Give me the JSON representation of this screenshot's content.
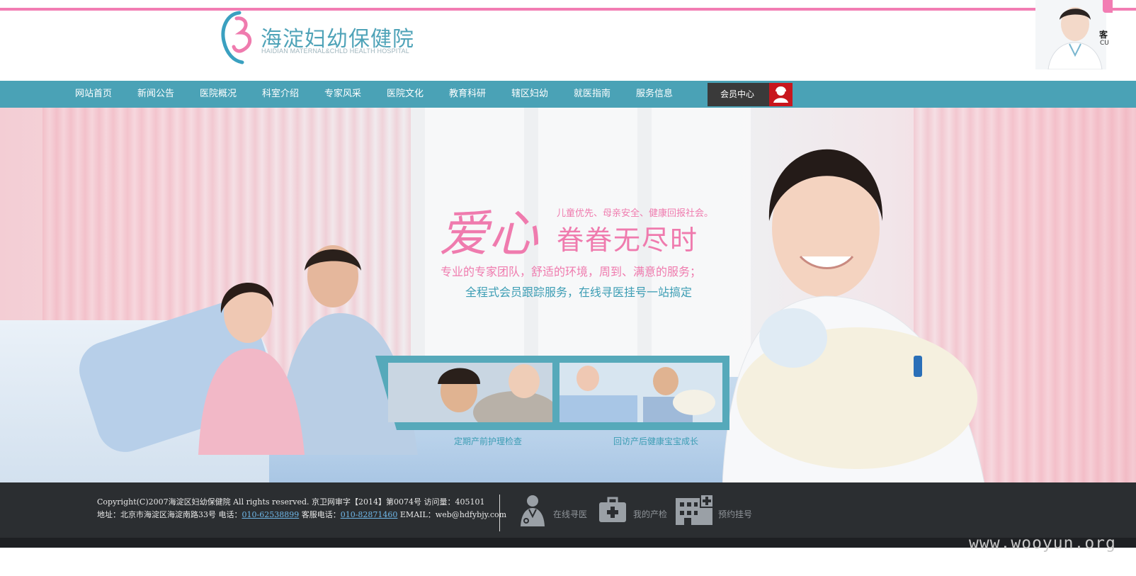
{
  "header": {
    "logo_cn": "海淀妇幼保健院",
    "logo_en": "HAIDIAN MATERNAL&CHLD HEALTH HOSPITAL",
    "cs_label": "客",
    "cs_label_en": "CU"
  },
  "nav": {
    "items": [
      {
        "label": "网站首页"
      },
      {
        "label": "新闻公告"
      },
      {
        "label": "医院概况"
      },
      {
        "label": "科室介绍"
      },
      {
        "label": "专家风采"
      },
      {
        "label": "医院文化"
      },
      {
        "label": "教育科研"
      },
      {
        "label": "辖区妇幼"
      },
      {
        "label": "就医指南"
      },
      {
        "label": "服务信息"
      }
    ],
    "member_label": "会员中心"
  },
  "banner": {
    "heart_title": "爱心",
    "subtitle_small": "儿童优先、母亲安全、健康回报社会。",
    "subtitle_big": "眷眷无尽时",
    "line1": "专业的专家团队，舒适的环境，周到、满意的服务；",
    "line2": "全程式会员跟踪服务，在线寻医挂号一站搞定",
    "thumbs": [
      {
        "caption": "定期产前护理检查"
      },
      {
        "caption": "回访产后健康宝宝成长"
      }
    ]
  },
  "footer": {
    "copyright": "Copyright(C)2007海淀区妇幼保健院 All rights reserved. 京卫网审字【2014】第0074号 访问量：405101",
    "address_prefix": "地址：北京市海淀区海淀南路33号 电话：",
    "phone": "010-62538899",
    "cs_phone_label": " 客服电话：",
    "cs_phone": "010-82871460",
    "email": " EMAIL：web@hdfybjy.com",
    "buttons": [
      {
        "label": "在线寻医",
        "icon": "doctor-icon"
      },
      {
        "label": "我的产检",
        "icon": "medkit-icon"
      },
      {
        "label": "预约挂号",
        "icon": "hospital-icon"
      }
    ]
  },
  "watermark": "www.wooyun.org",
  "colors": {
    "accent_pink": "#f27db3",
    "nav_teal": "#4aa2b6",
    "footer_bg": "#2b2e31",
    "member_red": "#c8161d"
  }
}
